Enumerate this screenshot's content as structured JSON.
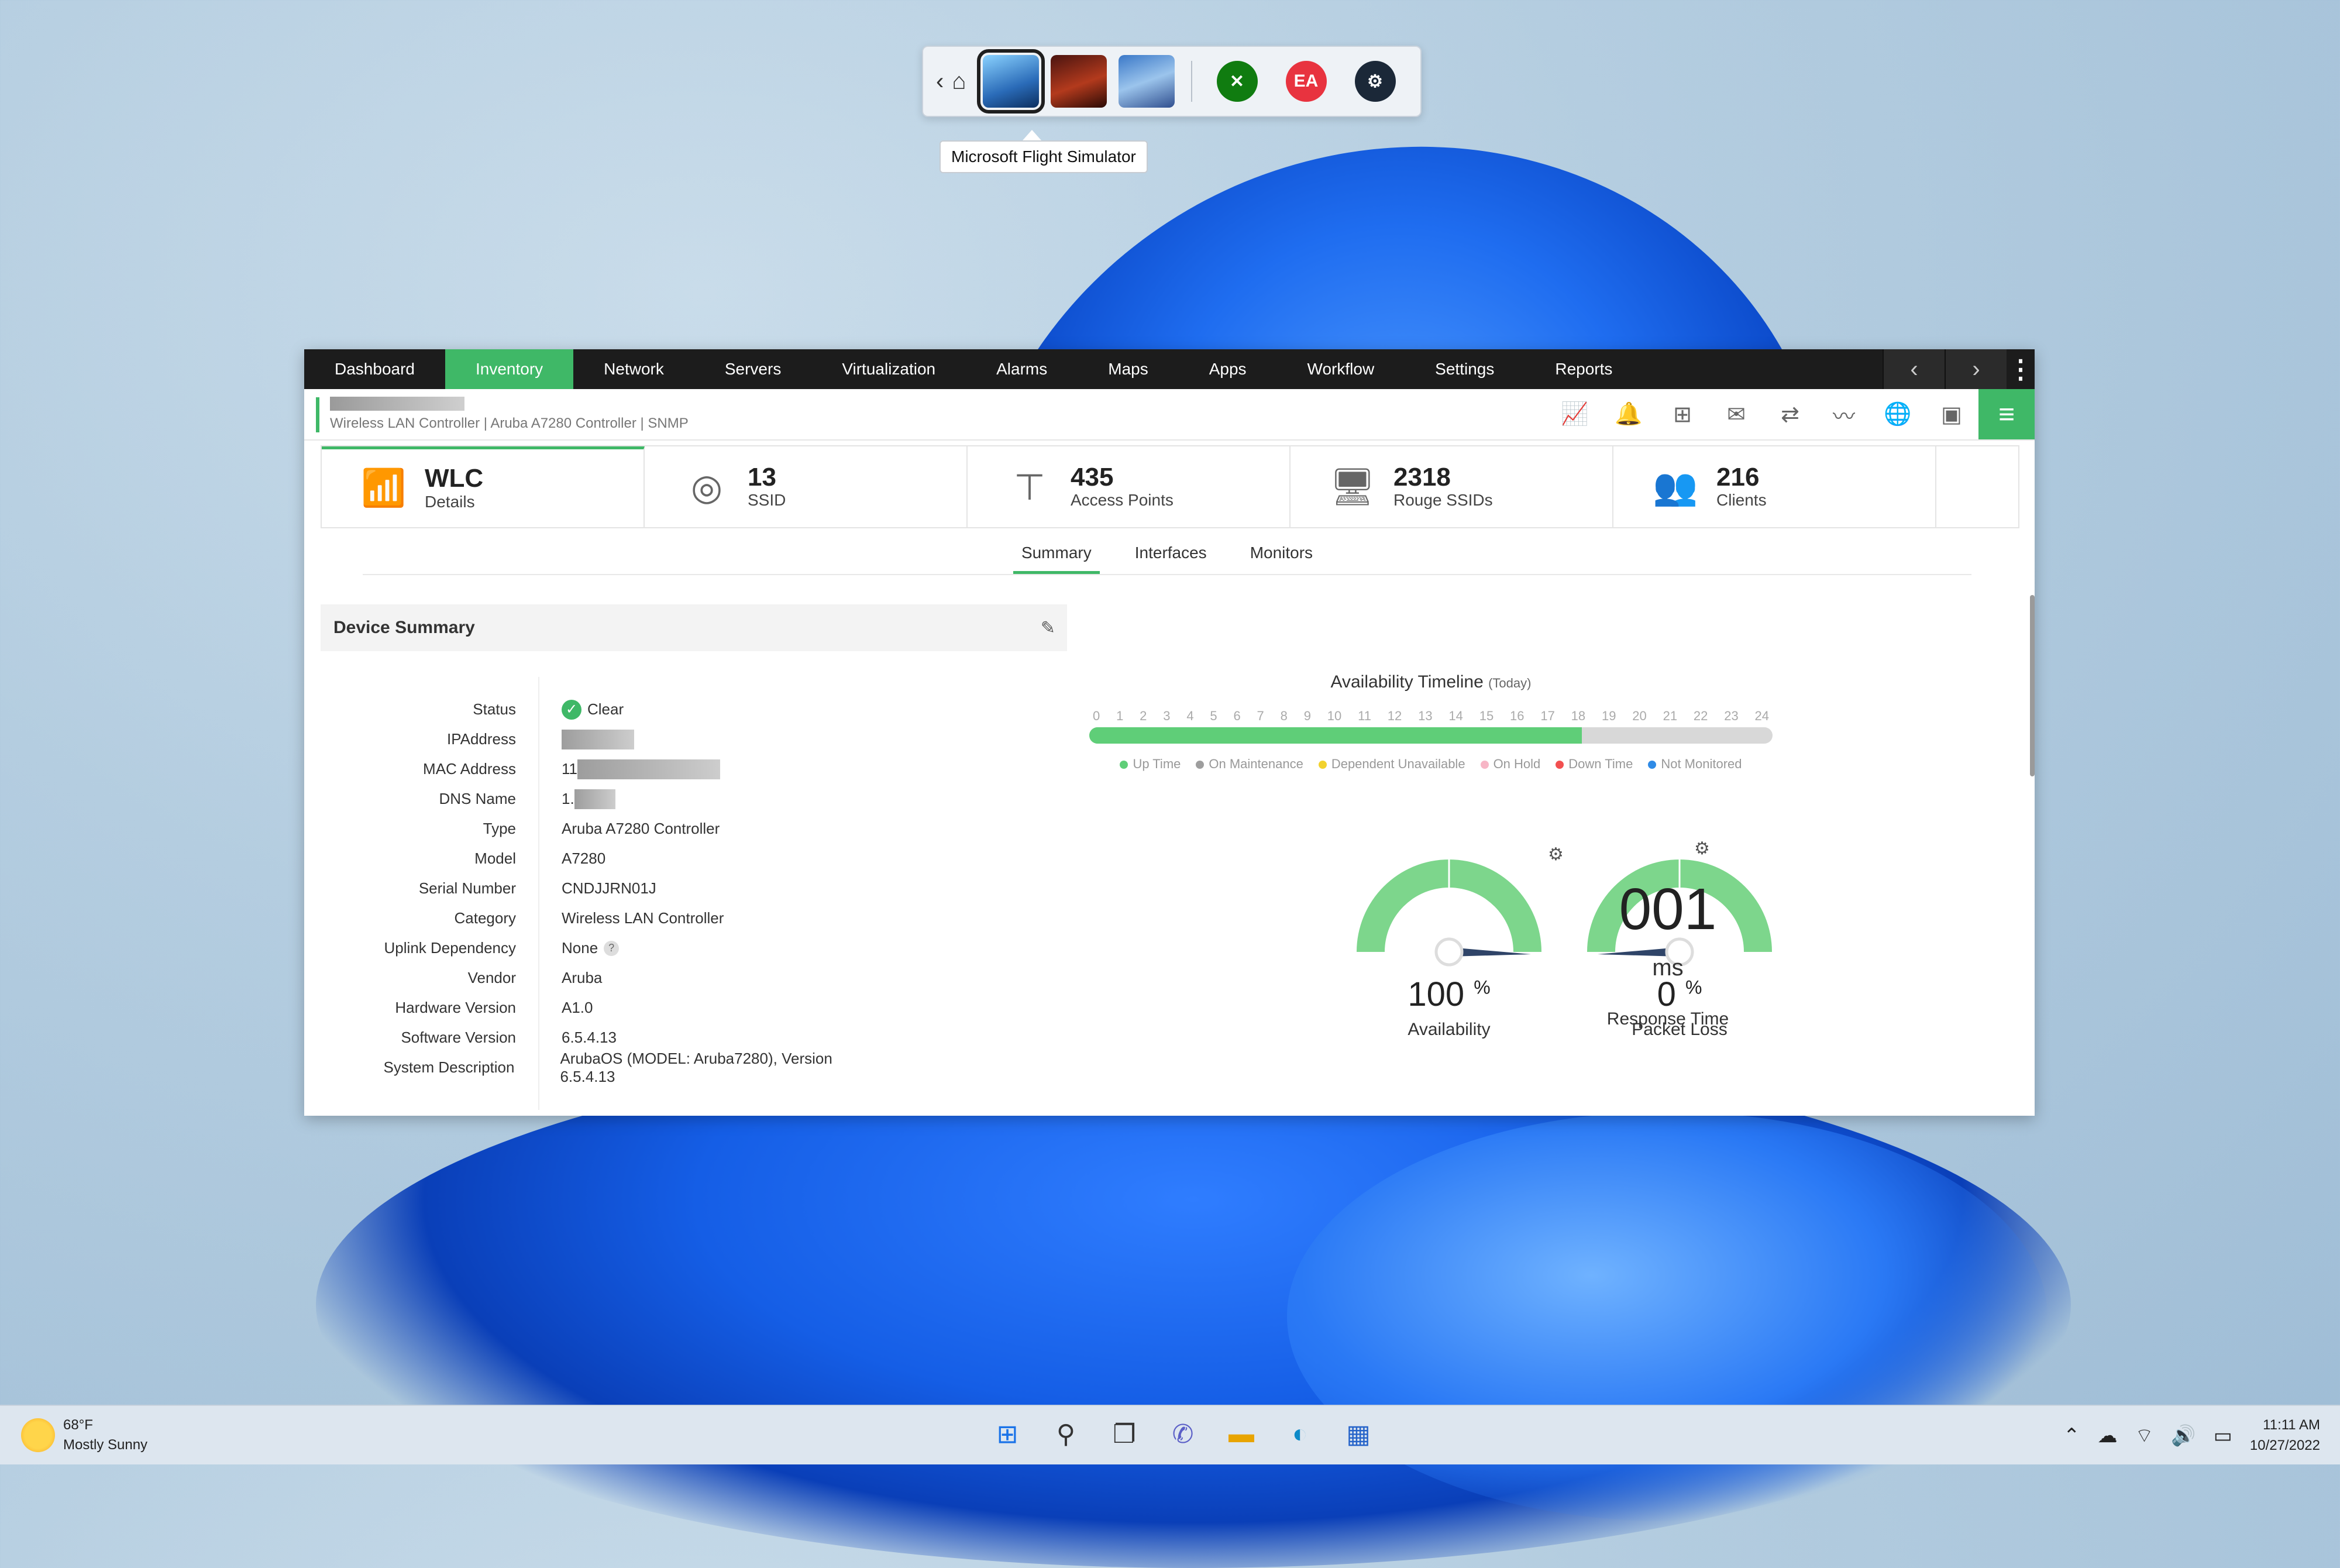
{
  "launcher": {
    "tooltip": "Microsoft Flight Simulator"
  },
  "nav": {
    "tabs": [
      {
        "label": "Dashboard",
        "active": false
      },
      {
        "label": "Inventory",
        "active": true
      },
      {
        "label": "Network",
        "active": false
      },
      {
        "label": "Servers",
        "active": false
      },
      {
        "label": "Virtualization",
        "active": false
      },
      {
        "label": "Alarms",
        "active": false
      },
      {
        "label": "Maps",
        "active": false
      },
      {
        "label": "Apps",
        "active": false
      },
      {
        "label": "Workflow",
        "active": false
      },
      {
        "label": "Settings",
        "active": false
      },
      {
        "label": "Reports",
        "active": false
      }
    ]
  },
  "device": {
    "subtitle": "Wireless LAN Controller | Aruba A7280 Controller | SNMP"
  },
  "cards": [
    {
      "value": "WLC",
      "label": "Details"
    },
    {
      "value": "13",
      "label": "SSID"
    },
    {
      "value": "435",
      "label": "Access Points"
    },
    {
      "value": "2318",
      "label": "Rouge SSIDs"
    },
    {
      "value": "216",
      "label": "Clients"
    }
  ],
  "subtabs": [
    {
      "label": "Summary",
      "active": true
    },
    {
      "label": "Interfaces",
      "active": false
    },
    {
      "label": "Monitors",
      "active": false
    }
  ],
  "summary": {
    "title": "Device Summary",
    "fields": [
      {
        "key": "Status",
        "value": "Clear"
      },
      {
        "key": "IPAddress",
        "value": ""
      },
      {
        "key": "MAC Address",
        "value": "11"
      },
      {
        "key": "DNS Name",
        "value": "1."
      },
      {
        "key": "Type",
        "value": "Aruba A7280 Controller"
      },
      {
        "key": "Model",
        "value": "A7280"
      },
      {
        "key": "Serial Number",
        "value": "CNDJJRN01J"
      },
      {
        "key": "Category",
        "value": "Wireless LAN Controller"
      },
      {
        "key": "Uplink Dependency",
        "value": "None"
      },
      {
        "key": "Vendor",
        "value": "Aruba"
      },
      {
        "key": "Hardware Version",
        "value": "A1.0"
      },
      {
        "key": "Software Version",
        "value": "6.5.4.13"
      },
      {
        "key": "System Description",
        "value": "ArubaOS (MODEL: Aruba7280), Version 6.5.4.13"
      }
    ]
  },
  "timeline": {
    "title": "Availability Timeline",
    "qualifier": "(Today)",
    "hours": [
      "0",
      "1",
      "2",
      "3",
      "4",
      "5",
      "6",
      "7",
      "8",
      "9",
      "10",
      "11",
      "12",
      "13",
      "14",
      "15",
      "16",
      "17",
      "18",
      "19",
      "20",
      "21",
      "22",
      "23",
      "24"
    ],
    "uptime_until_hour": 17.3,
    "legend": [
      {
        "label": "Up Time",
        "color": "#5fce78"
      },
      {
        "label": "On Maintenance",
        "color": "#9e9e9e"
      },
      {
        "label": "Dependent Unavailable",
        "color": "#f2d22e"
      },
      {
        "label": "On Hold",
        "color": "#f7b6c6"
      },
      {
        "label": "Down Time",
        "color": "#f25050"
      },
      {
        "label": "Not Monitored",
        "color": "#2f8be6"
      }
    ]
  },
  "gauges": [
    {
      "value": "100",
      "unit": "%",
      "label": "Availability",
      "percent": 100
    },
    {
      "value": "0",
      "unit": "%",
      "label": "Packet Loss",
      "percent": 0
    }
  ],
  "response_time": {
    "value": "001",
    "unit": "ms",
    "label": "Response Time"
  },
  "weather": {
    "temp": "68°F",
    "condition": "Mostly Sunny"
  },
  "clock": {
    "time": "11:11 AM",
    "date": "10/27/2022"
  },
  "colors": {
    "accent": "#3fb867",
    "nav_bg": "#1c1c1c"
  }
}
